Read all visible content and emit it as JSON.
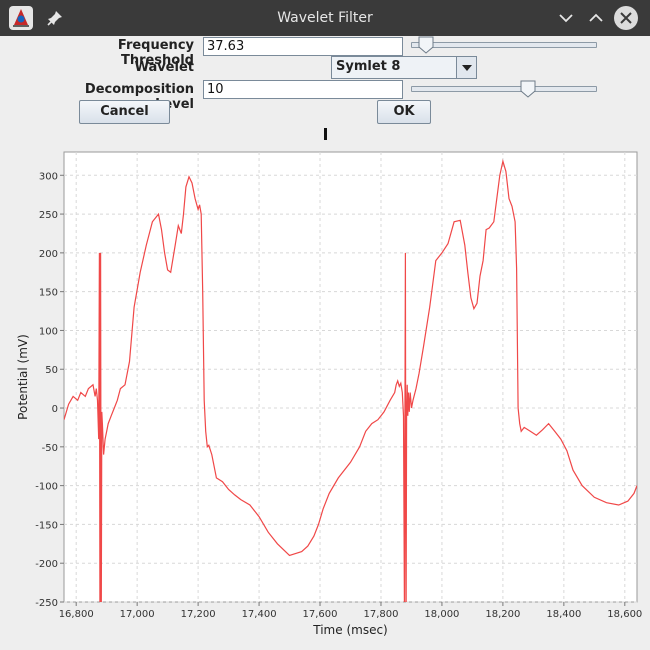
{
  "window": {
    "title": "Wavelet Filter",
    "icons": [
      "app-icon",
      "pin-icon",
      "minimize-icon",
      "maximize-icon",
      "close-icon"
    ]
  },
  "form": {
    "frequency_threshold": {
      "label": "Frequency Threshold",
      "value": "37.63",
      "slider_fraction": 0.04
    },
    "wavelet": {
      "label": "Wavelet",
      "selected": "Symlet 8"
    },
    "decomposition_level": {
      "label": "Decomposition Level",
      "value": "10",
      "slider_fraction": 0.64
    },
    "cancel_label": "Cancel",
    "ok_label": "OK"
  },
  "colors": {
    "series": "#f04848",
    "grid": "#d8d8d8",
    "plot_bg": "#ffffff",
    "page_bg": "#eeeeee"
  },
  "chart_data": {
    "type": "line",
    "xlabel": "Time (msec)",
    "ylabel": "Potential (mV)",
    "xlim": [
      16760,
      18640
    ],
    "ylim": [
      -250,
      330
    ],
    "grid": true,
    "x_ticks": [
      16800,
      17000,
      17200,
      17400,
      17600,
      17800,
      18000,
      18200,
      18400,
      18600
    ],
    "x_tick_labels": [
      "16,800",
      "17,000",
      "17,200",
      "17,400",
      "17,600",
      "17,800",
      "18,000",
      "18,200",
      "18,400",
      "18,600"
    ],
    "y_ticks": [
      300,
      250,
      200,
      150,
      100,
      50,
      0,
      -50,
      -100,
      -150,
      -200,
      -250
    ],
    "y_tick_labels": [
      "300",
      "250",
      "200",
      "150",
      "100",
      "50",
      "0",
      "-50",
      "-100",
      "-150",
      "-200",
      "-250"
    ],
    "series": [
      {
        "color": "#f04848",
        "x": [
          16760,
          16775,
          16790,
          16805,
          16815,
          16830,
          16840,
          16855,
          16862,
          16866,
          16870,
          16874,
          16876,
          16878,
          16880,
          16882,
          16884,
          16886,
          16890,
          16895,
          16900,
          16905,
          16915,
          16925,
          16935,
          16945,
          16960,
          16975,
          16990,
          17010,
          17030,
          17050,
          17070,
          17080,
          17090,
          17100,
          17110,
          17125,
          17135,
          17145,
          17152,
          17160,
          17170,
          17180,
          17190,
          17200,
          17205,
          17210,
          17215,
          17220,
          17225,
          17230,
          17235,
          17245,
          17260,
          17280,
          17300,
          17320,
          17340,
          17370,
          17400,
          17430,
          17460,
          17500,
          17540,
          17560,
          17580,
          17595,
          17610,
          17630,
          17660,
          17700,
          17730,
          17750,
          17770,
          17790,
          17810,
          17830,
          17845,
          17850,
          17855,
          17860,
          17865,
          17870,
          17874,
          17877,
          17880,
          17882,
          17884,
          17886,
          17888,
          17890,
          17893,
          17896,
          17900,
          17905,
          17915,
          17925,
          17940,
          17960,
          17980,
          18000,
          18020,
          18040,
          18060,
          18075,
          18085,
          18095,
          18105,
          18115,
          18125,
          18135,
          18145,
          18155,
          18170,
          18180,
          18190,
          18200,
          18210,
          18220,
          18230,
          18240,
          18245,
          18250,
          18255,
          18260,
          18270,
          18290,
          18310,
          18330,
          18350,
          18370,
          18390,
          18410,
          18430,
          18460,
          18500,
          18540,
          18580,
          18610,
          18630,
          18640
        ],
        "y": [
          -15,
          5,
          15,
          10,
          20,
          15,
          25,
          30,
          15,
          25,
          10,
          -40,
          200,
          -330,
          200,
          -310,
          -5,
          -20,
          -60,
          -40,
          -30,
          -20,
          -10,
          0,
          10,
          25,
          30,
          60,
          130,
          175,
          210,
          240,
          250,
          230,
          200,
          178,
          175,
          210,
          235,
          225,
          250,
          285,
          298,
          290,
          270,
          256,
          262,
          250,
          150,
          10,
          -30,
          -50,
          -48,
          -60,
          -90,
          -95,
          -105,
          -112,
          -118,
          -125,
          -140,
          -160,
          -175,
          -190,
          -185,
          -178,
          -165,
          -150,
          -130,
          -110,
          -90,
          -70,
          -50,
          -30,
          -20,
          -15,
          -5,
          10,
          20,
          30,
          35,
          28,
          32,
          20,
          -10,
          -250,
          200,
          -330,
          -5,
          30,
          -10,
          20,
          -5,
          20,
          0,
          10,
          25,
          45,
          80,
          130,
          190,
          200,
          212,
          240,
          242,
          210,
          175,
          142,
          128,
          135,
          170,
          190,
          230,
          232,
          240,
          270,
          300,
          318,
          305,
          270,
          260,
          240,
          180,
          0,
          -20,
          -30,
          -25,
          -30,
          -35,
          -28,
          -20,
          -30,
          -40,
          -55,
          -80,
          -100,
          -115,
          -122,
          -125,
          -120,
          -110,
          -100
        ]
      }
    ]
  }
}
